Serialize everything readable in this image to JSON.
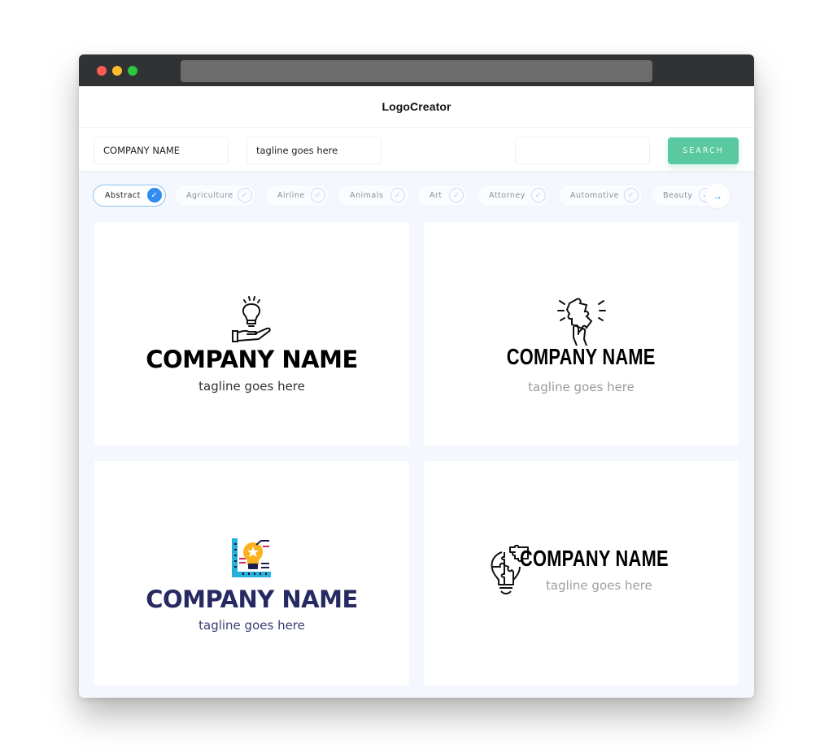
{
  "window": {
    "traffic_lights": [
      "close",
      "minimize",
      "maximize"
    ],
    "colors": {
      "red": "#fd5b54",
      "yellow": "#febb2e",
      "green": "#2ac840"
    }
  },
  "header": {
    "title": "LogoCreator"
  },
  "search": {
    "company_value": "COMPANY NAME",
    "tagline_value": "tagline goes here",
    "keyword_value": "",
    "button_label": "SEARCH",
    "button_color": "#5ac8a0"
  },
  "categories": {
    "items": [
      {
        "label": "Abstract",
        "selected": true
      },
      {
        "label": "Agriculture",
        "selected": false
      },
      {
        "label": "Airline",
        "selected": false
      },
      {
        "label": "Animals",
        "selected": false
      },
      {
        "label": "Art",
        "selected": false
      },
      {
        "label": "Attorney",
        "selected": false
      },
      {
        "label": "Automotive",
        "selected": false
      },
      {
        "label": "Beauty",
        "selected": false
      }
    ],
    "check_glyph": "✓",
    "next_glyph": "→",
    "accent": "#2f8cf0"
  },
  "logos": [
    {
      "icon": "lightbulb-hand-icon",
      "company": "COMPANY NAME",
      "tagline": "tagline goes here",
      "name_color": "#000000",
      "tagline_color": "#333333"
    },
    {
      "icon": "puzzle-hand-icon",
      "company": "COMPANY NAME",
      "tagline": "tagline goes here",
      "name_color": "#000000",
      "tagline_color": "#9a9a9a"
    },
    {
      "icon": "lightbulb-blueprint-icon",
      "company": "COMPANY NAME",
      "tagline": "tagline goes here",
      "name_color": "#272a62",
      "tagline_color": "#3a3d73"
    },
    {
      "icon": "puzzle-lightbulb-icon",
      "company": "COMPANY NAME",
      "tagline": "tagline goes here",
      "name_color": "#000000",
      "tagline_color": "#a0a0a0"
    }
  ]
}
